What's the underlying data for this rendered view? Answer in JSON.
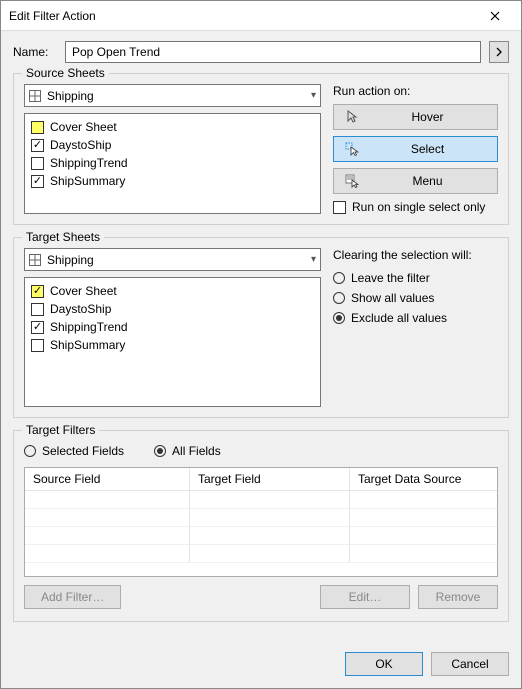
{
  "dialog": {
    "title": "Edit Filter Action"
  },
  "name": {
    "label": "Name:",
    "value": "Pop Open Trend"
  },
  "source": {
    "legend": "Source Sheets",
    "dashboard": "Shipping",
    "items": [
      {
        "label": "Cover Sheet",
        "state": "partial"
      },
      {
        "label": "DaystoShip",
        "state": "checked"
      },
      {
        "label": "ShippingTrend",
        "state": "unchecked"
      },
      {
        "label": "ShipSummary",
        "state": "checked"
      }
    ],
    "run_label": "Run action on:",
    "actions": {
      "hover": "Hover",
      "select": "Select",
      "menu": "Menu"
    },
    "run_single": "Run on single select only"
  },
  "target": {
    "legend": "Target Sheets",
    "dashboard": "Shipping",
    "items": [
      {
        "label": "Cover Sheet",
        "state": "checked"
      },
      {
        "label": "DaystoShip",
        "state": "unchecked"
      },
      {
        "label": "ShippingTrend",
        "state": "checked"
      },
      {
        "label": "ShipSummary",
        "state": "unchecked"
      }
    ],
    "clear_label": "Clearing the selection will:",
    "clear_options": {
      "leave": "Leave the filter",
      "show": "Show all values",
      "exclude": "Exclude all values"
    },
    "clear_selected": "exclude"
  },
  "filters": {
    "legend": "Target Filters",
    "fields_mode": {
      "selected": "Selected Fields",
      "all": "All Fields"
    },
    "fields_mode_value": "all",
    "columns": {
      "source": "Source Field",
      "target": "Target Field",
      "ds": "Target Data Source"
    },
    "buttons": {
      "add": "Add Filter…",
      "edit": "Edit…",
      "remove": "Remove"
    }
  },
  "footer": {
    "ok": "OK",
    "cancel": "Cancel"
  }
}
